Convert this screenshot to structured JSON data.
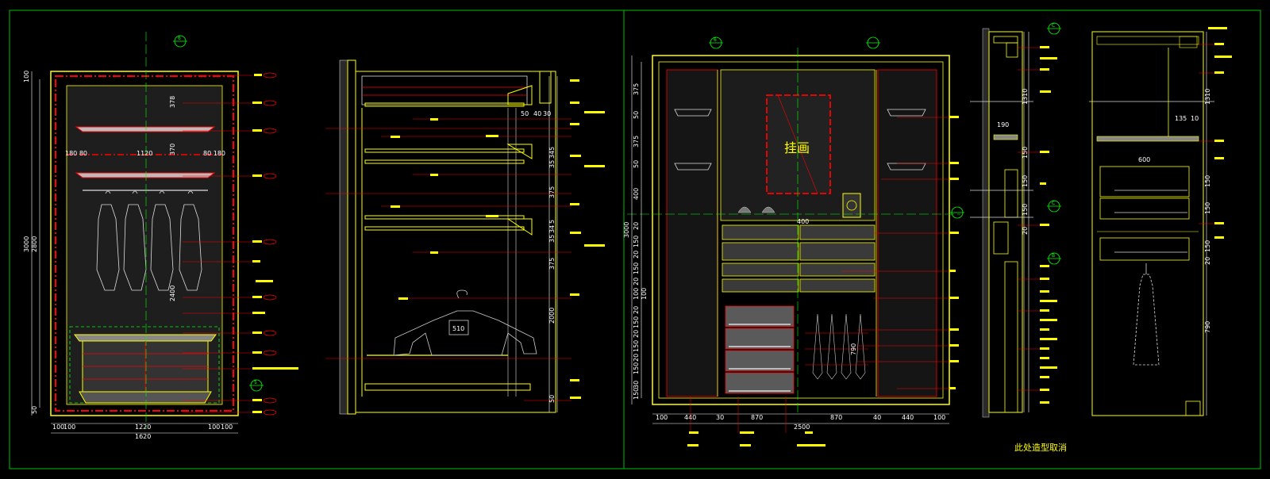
{
  "drawing": {
    "colors": {
      "background": "#000000",
      "frame": "#00c000",
      "wall": "#ff0000",
      "dimension": "#ffffff",
      "furniture": "#ffff00",
      "leader": "#ff0000",
      "detail": "#c0c0c0"
    },
    "axis_marks": [
      {
        "label": "6"
      },
      {
        "label": "5"
      },
      {
        "label": "6"
      },
      {
        "label": "C"
      },
      {
        "label": "C"
      },
      {
        "label": "B"
      }
    ],
    "elevation_a": {
      "dims_bottom": [
        "100",
        "100",
        "1220",
        "100",
        "100",
        "1620"
      ],
      "dims_left": [
        "100",
        "3000",
        "2800",
        "50"
      ],
      "dims_inner": [
        "378",
        "370",
        "1120",
        "180 80",
        "80 180",
        "2400"
      ]
    },
    "elevation_b": {
      "dims_right": [
        "50",
        "40",
        "30",
        "5",
        "34",
        "35",
        "375",
        "5",
        "34",
        "35",
        "375",
        "2000",
        "50"
      ],
      "hanger_label": "510"
    },
    "elevation_c": {
      "painting_label": "挂画",
      "dims_bottom": [
        "100",
        "440",
        "30",
        "870",
        "2500",
        "870",
        "40",
        "440",
        "100"
      ],
      "dims_left": [
        "375",
        "50",
        "375",
        "50",
        "400",
        "3000",
        "20",
        "150",
        "20",
        "150",
        "20",
        "100",
        "100",
        "20",
        "150",
        "20",
        "150",
        "20",
        "150",
        "30",
        "150"
      ],
      "dims_center": [
        "400",
        "790"
      ]
    },
    "elevation_d": {
      "dims": [
        "1310",
        "190",
        "150",
        "150",
        "150",
        "20"
      ]
    },
    "elevation_e": {
      "dims": [
        "1310",
        "135",
        "10",
        "600",
        "150",
        "150",
        "150",
        "20",
        "790"
      ]
    },
    "cancel_note": "此处造型取消"
  }
}
